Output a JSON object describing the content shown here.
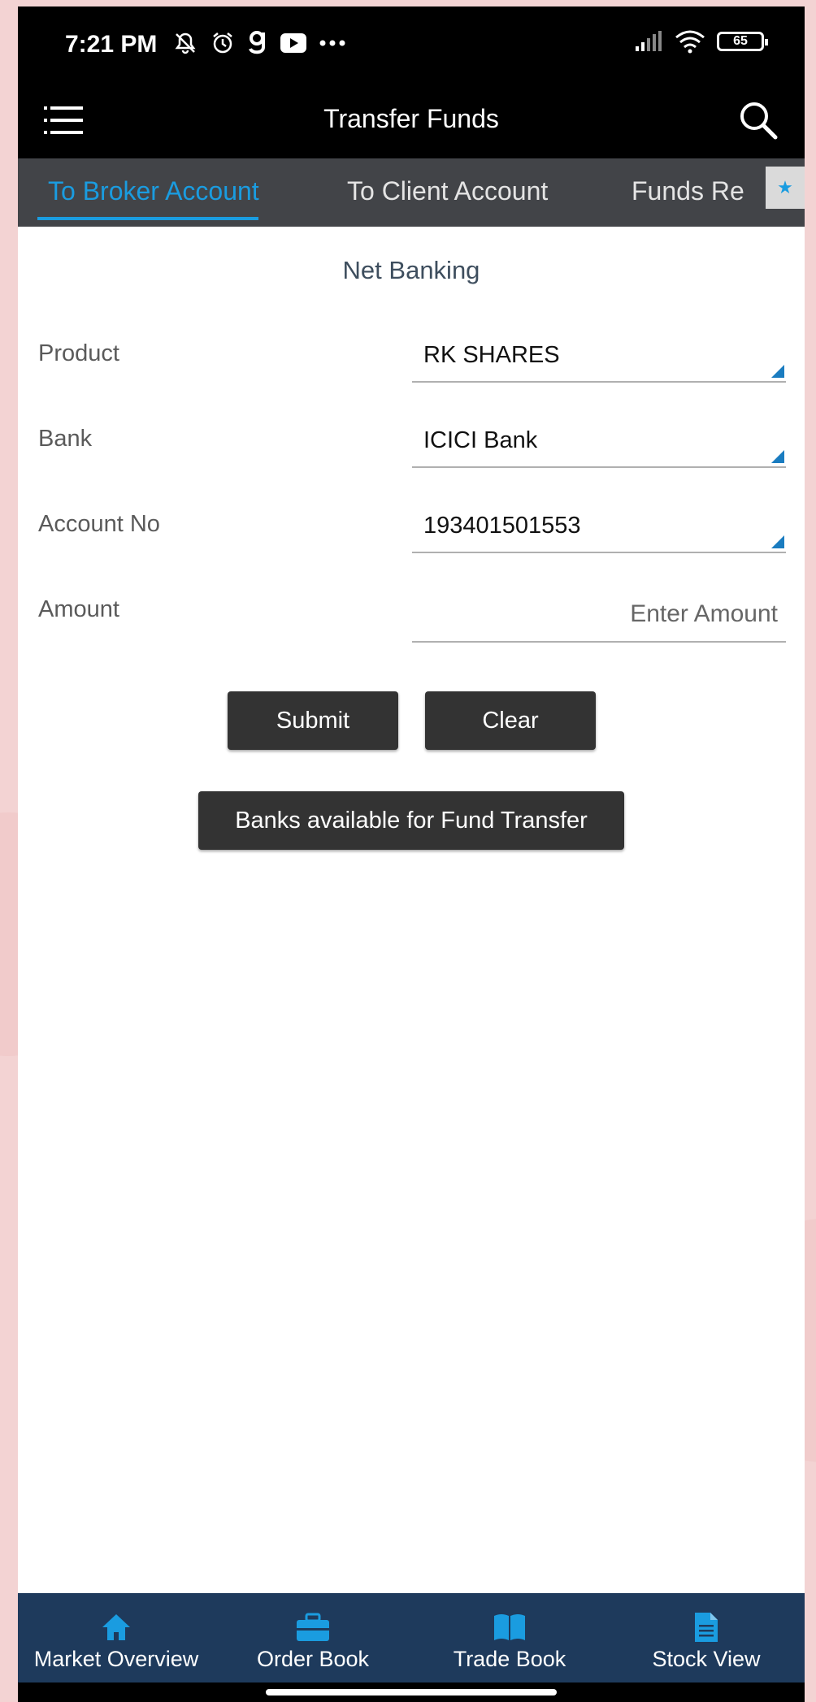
{
  "status_bar": {
    "time": "7:21 PM",
    "battery": "65",
    "icons_left": [
      "mute-icon",
      "alarm-icon",
      "g-app-icon",
      "youtube-icon",
      "more-dots-icon"
    ],
    "icons_right": [
      "signal-icon",
      "wifi-icon",
      "battery-icon"
    ]
  },
  "header": {
    "title": "Transfer Funds",
    "menu_icon": "hamburger-icon",
    "search_icon": "search-icon"
  },
  "tabs": [
    {
      "label": "To Broker Account",
      "active": true
    },
    {
      "label": "To Client Account",
      "active": false
    },
    {
      "label": "Funds Re",
      "active": false
    }
  ],
  "form": {
    "section_title": "Net Banking",
    "fields": {
      "product": {
        "label": "Product",
        "value": "RK SHARES"
      },
      "bank": {
        "label": "Bank",
        "value": "ICICI Bank"
      },
      "account_no": {
        "label": "Account No",
        "value": "193401501553"
      },
      "amount": {
        "label": "Amount",
        "value": "",
        "placeholder": "Enter Amount"
      }
    },
    "submit_label": "Submit",
    "clear_label": "Clear",
    "banks_label": "Banks available for Fund Transfer"
  },
  "bottom_nav": [
    {
      "label": "Market Overview",
      "icon": "home-icon"
    },
    {
      "label": "Order Book",
      "icon": "briefcase-icon"
    },
    {
      "label": "Trade Book",
      "icon": "book-icon"
    },
    {
      "label": "Stock View",
      "icon": "document-icon"
    }
  ],
  "colors": {
    "accent": "#1a9ce0",
    "tab_bar": "#424448",
    "bottom_nav": "#1e3a5c",
    "button": "#333333"
  }
}
